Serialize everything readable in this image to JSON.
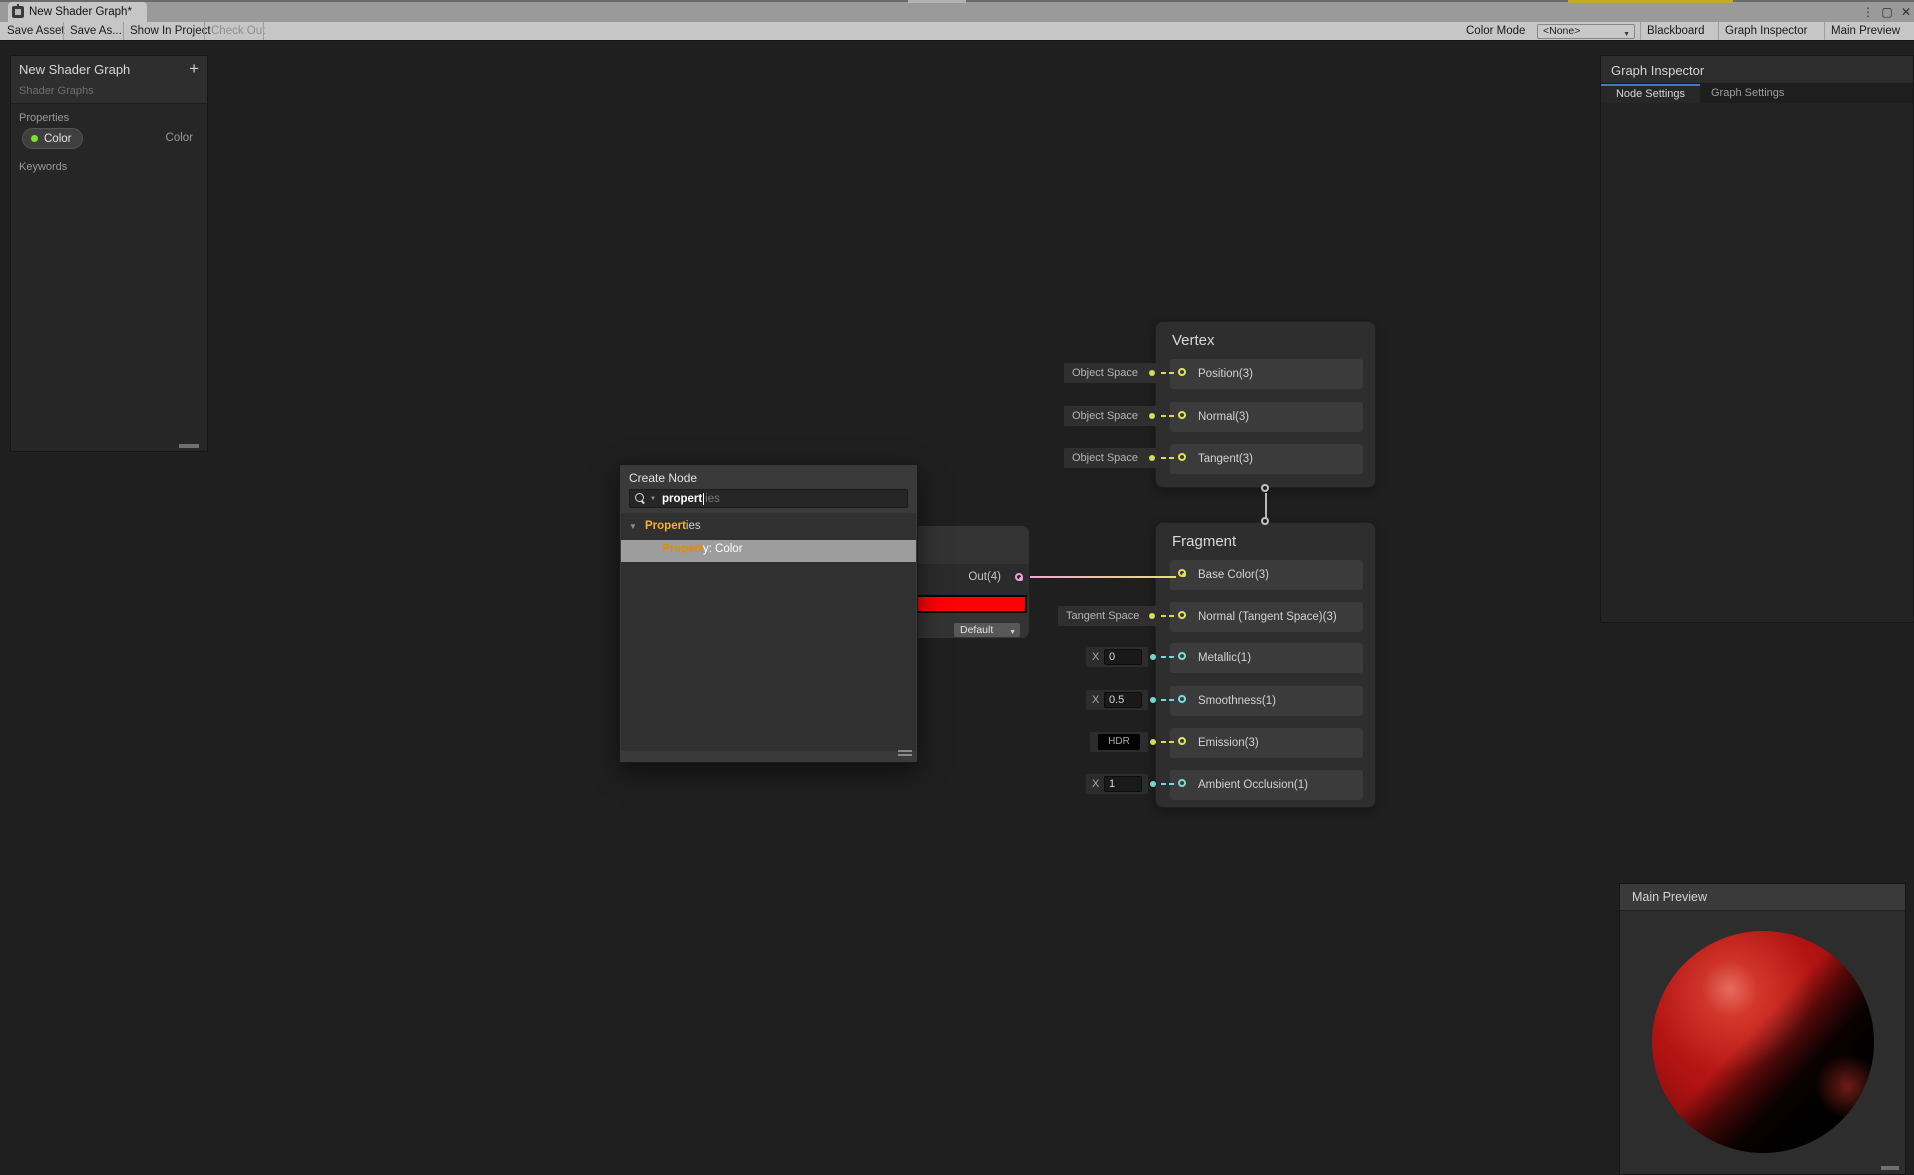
{
  "window": {
    "tab_title": "New Shader Graph*"
  },
  "icons": {
    "kebab": "⋮",
    "maximize": "▢",
    "close": "✕",
    "dropdown_arrow": "▼",
    "foldout_arrow": "▼",
    "plus": "+"
  },
  "toolbar": {
    "buttons_left": [
      {
        "label": "Save Asset",
        "enabled": true
      },
      {
        "label": "Save As...",
        "enabled": true
      },
      {
        "label": "Show In Project",
        "enabled": true
      },
      {
        "label": "Check Out",
        "enabled": false
      }
    ],
    "color_mode_label": "Color Mode",
    "color_mode_value": "<None>",
    "buttons_right": [
      {
        "label": "Blackboard"
      },
      {
        "label": "Graph Inspector"
      },
      {
        "label": "Main Preview"
      }
    ]
  },
  "blackboard": {
    "title": "New Shader Graph",
    "subtitle": "Shader Graphs",
    "properties_label": "Properties",
    "keywords_label": "Keywords",
    "property": {
      "name": "Color",
      "type": "Color"
    }
  },
  "graph_inspector": {
    "title": "Graph Inspector",
    "tabs": [
      {
        "label": "Node Settings",
        "active": true
      },
      {
        "label": "Graph Settings",
        "active": false
      }
    ]
  },
  "create_node": {
    "title": "Create Node",
    "search": {
      "typed": "propert",
      "ghost": "ies"
    },
    "category": {
      "match": "Propert",
      "rest": "ies"
    },
    "result": {
      "match": "Propert",
      "rest": "y: Color"
    }
  },
  "color_node": {
    "out_label": "Out(4)",
    "swatch_color": "#fb0207",
    "mode_value": "Default"
  },
  "vertex_node": {
    "title": "Vertex",
    "rows": [
      {
        "tag": "Object Space",
        "label": "Position(3)"
      },
      {
        "tag": "Object Space",
        "label": "Normal(3)"
      },
      {
        "tag": "Object Space",
        "label": "Tangent(3)"
      }
    ]
  },
  "fragment_node": {
    "title": "Fragment",
    "rows": [
      {
        "label": "Base Color(3)",
        "connected": true
      },
      {
        "tag": "Tangent Space",
        "label": "Normal (Tangent Space)(3)"
      },
      {
        "control_label": "X",
        "value": "0",
        "label": "Metallic(1)"
      },
      {
        "control_label": "X",
        "value": "0.5",
        "label": "Smoothness(1)"
      },
      {
        "control_label": "HDR",
        "label": "Emission(3)"
      },
      {
        "control_label": "X",
        "value": "1",
        "label": "Ambient Occlusion(1)"
      }
    ]
  },
  "main_preview": {
    "title": "Main Preview"
  },
  "colors": {
    "accent_blue": "#3e7cc4",
    "port_vector3_yellow": "#e3e35a",
    "port_vector1_cyan": "#7adede",
    "port_vector4_pink": "#f2a0da",
    "edge_gradient": [
      "#eea6d8",
      "#e2e272"
    ],
    "swatch_red": "#fb0207",
    "sphere_red": "#b01312",
    "property_dot_green": "#7ce22d",
    "search_highlight_orange": "#f7b02c"
  }
}
